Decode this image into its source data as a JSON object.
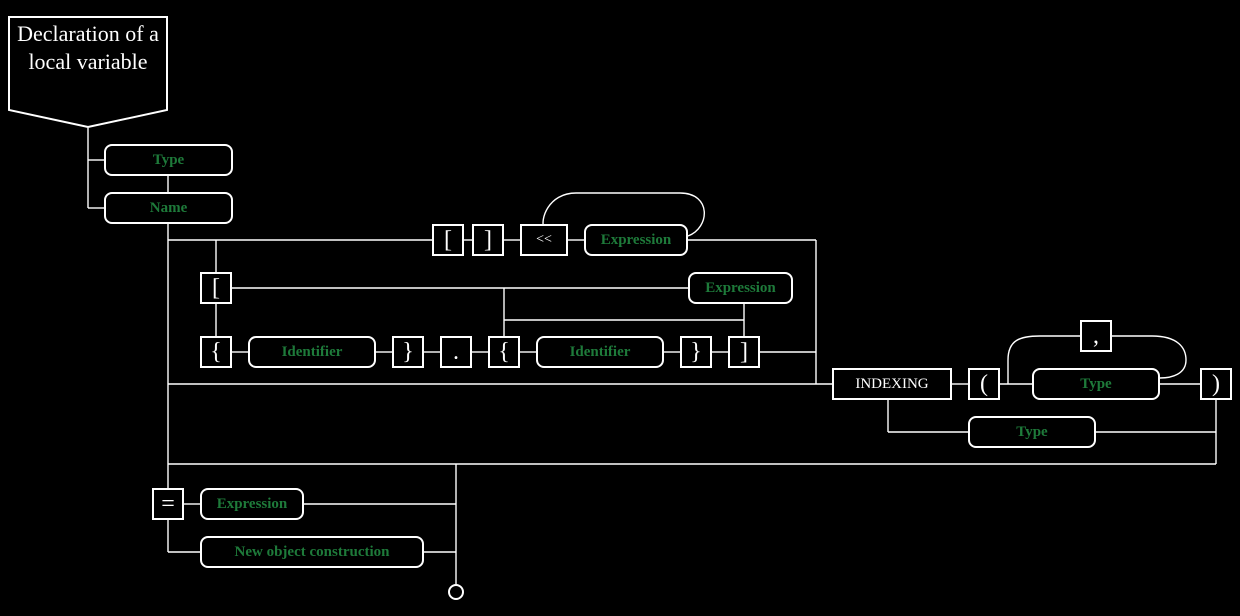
{
  "diagram": {
    "title": "Declaration of a local variable",
    "rules": {
      "type_top": "Type",
      "name": "Name",
      "expression_top": "Expression",
      "expression_mid": "Expression",
      "identifier_1": "Identifier",
      "identifier_2": "Identifier",
      "type_indexing": "Type",
      "type_alt": "Type",
      "expression_init": "Expression",
      "new_object": "New object construction"
    },
    "terminals": {
      "open_bracket_top": "[",
      "close_bracket_top": "]",
      "shift_left": "<<",
      "open_bracket_mid": "[",
      "open_brace_1": "{",
      "close_brace_1": "}",
      "dot": ".",
      "open_brace_2": "{",
      "close_brace_2": "}",
      "close_bracket_mid": "]",
      "indexing": "INDEXING",
      "open_paren": "(",
      "comma": ",",
      "close_paren": ")",
      "equals": "="
    }
  }
}
